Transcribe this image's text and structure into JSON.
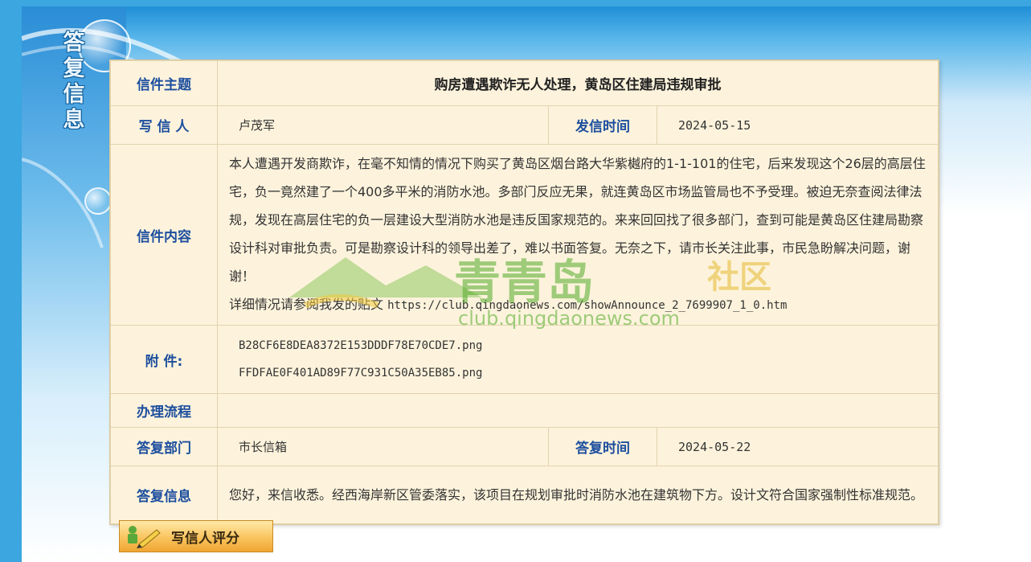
{
  "sidebar": {
    "title": "答复信息"
  },
  "letter": {
    "subject_label": "信件主题",
    "subject": "购房遭遇欺诈无人处理，黄岛区住建局违规审批",
    "writer_label": "写 信 人",
    "writer": "卢茂军",
    "sent_time_label": "发信时间",
    "sent_time": "2024-05-15",
    "content_label": "信件内容",
    "content": "本人遭遇开发商欺诈，在毫不知情的情况下购买了黄岛区烟台路大华紫樾府的1-1-101的住宅，后来发现这个26层的高层住宅，负一竟然建了一个400多平米的消防水池。多部门反应无果，就连黄岛区市场监管局也不予受理。被迫无奈查阅法律法规，发现在高层住宅的负一层建设大型消防水池是违反国家规范的。来来回回找了很多部门，查到可能是黄岛区住建局勘察设计科对审批负责。可是勘察设计科的领导出差了，难以书面答复。无奈之下，请市长关注此事，市民急盼解决问题，谢谢！",
    "content_link_prefix": "详细情况请参阅我发的贴文",
    "content_link": "https://club.qingdaonews.com/showAnnounce_2_7699907_1_0.htm",
    "attachment_label": "附 件:",
    "attachments": [
      "B28CF6E8DEA8372E153DDDF78E70CDE7.png",
      "FFDFAE0F401AD89F77C931C50A35EB85.png"
    ],
    "process_label": "办理流程",
    "process": "",
    "reply_dept_label": "答复部门",
    "reply_dept": "市长信箱",
    "reply_time_label": "答复时间",
    "reply_time": "2024-05-22",
    "reply_label": "答复信息",
    "reply": "您好，来信收悉。经西海岸新区管委落实，该项目在规划审批时消防水池在建筑物下方。设计文符合国家强制性标准规范。"
  },
  "watermark": {
    "brand": "青青岛",
    "suffix": "社区",
    "url": "club.qingdaonews.com"
  },
  "rate_button": {
    "label": "写信人评分"
  },
  "colors": {
    "label_blue": "#1c4e9e",
    "panel_bg": "#fdf3dc",
    "header_blue": "#1f8fd7",
    "watermark_green": "#50aa28"
  }
}
